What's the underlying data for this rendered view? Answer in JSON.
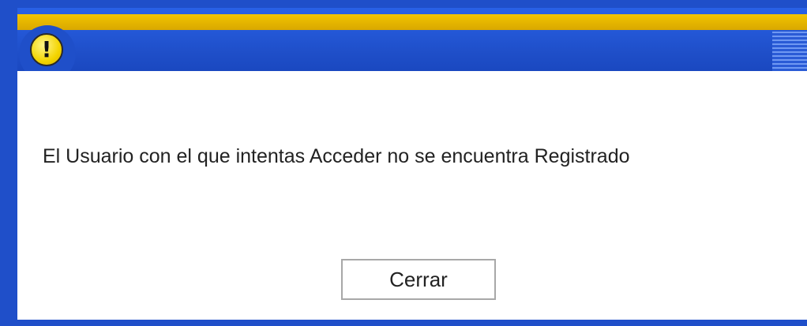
{
  "dialog": {
    "icon": "warning-icon",
    "icon_glyph": "!",
    "message": "El Usuario con el que intentas Acceder no se encuentra Registrado",
    "close_label": "Cerrar"
  },
  "colors": {
    "frame_blue": "#1f4fc9",
    "title_gold": "#f2c400",
    "icon_yellow": "#f3d400",
    "background": "#ffffff",
    "button_border": "#a8a8a8"
  }
}
